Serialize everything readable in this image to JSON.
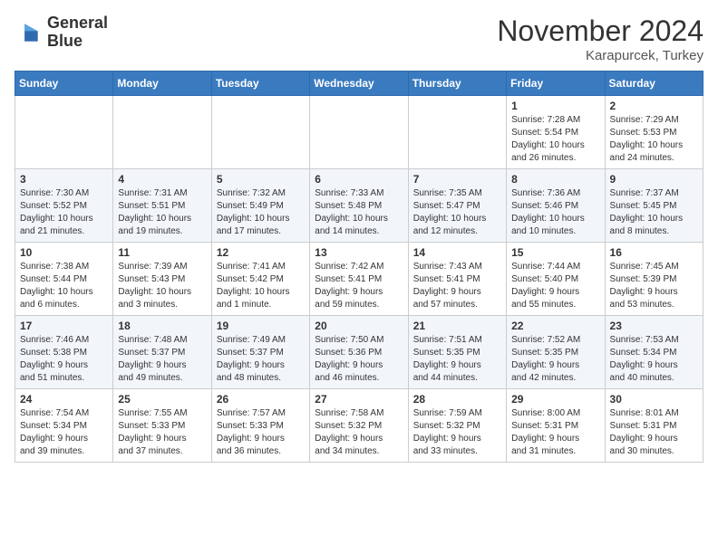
{
  "header": {
    "logo_line1": "General",
    "logo_line2": "Blue",
    "month": "November 2024",
    "location": "Karapurcek, Turkey"
  },
  "days_of_week": [
    "Sunday",
    "Monday",
    "Tuesday",
    "Wednesday",
    "Thursday",
    "Friday",
    "Saturday"
  ],
  "weeks": [
    [
      {
        "day": "",
        "info": ""
      },
      {
        "day": "",
        "info": ""
      },
      {
        "day": "",
        "info": ""
      },
      {
        "day": "",
        "info": ""
      },
      {
        "day": "",
        "info": ""
      },
      {
        "day": "1",
        "info": "Sunrise: 7:28 AM\nSunset: 5:54 PM\nDaylight: 10 hours\nand 26 minutes."
      },
      {
        "day": "2",
        "info": "Sunrise: 7:29 AM\nSunset: 5:53 PM\nDaylight: 10 hours\nand 24 minutes."
      }
    ],
    [
      {
        "day": "3",
        "info": "Sunrise: 7:30 AM\nSunset: 5:52 PM\nDaylight: 10 hours\nand 21 minutes."
      },
      {
        "day": "4",
        "info": "Sunrise: 7:31 AM\nSunset: 5:51 PM\nDaylight: 10 hours\nand 19 minutes."
      },
      {
        "day": "5",
        "info": "Sunrise: 7:32 AM\nSunset: 5:49 PM\nDaylight: 10 hours\nand 17 minutes."
      },
      {
        "day": "6",
        "info": "Sunrise: 7:33 AM\nSunset: 5:48 PM\nDaylight: 10 hours\nand 14 minutes."
      },
      {
        "day": "7",
        "info": "Sunrise: 7:35 AM\nSunset: 5:47 PM\nDaylight: 10 hours\nand 12 minutes."
      },
      {
        "day": "8",
        "info": "Sunrise: 7:36 AM\nSunset: 5:46 PM\nDaylight: 10 hours\nand 10 minutes."
      },
      {
        "day": "9",
        "info": "Sunrise: 7:37 AM\nSunset: 5:45 PM\nDaylight: 10 hours\nand 8 minutes."
      }
    ],
    [
      {
        "day": "10",
        "info": "Sunrise: 7:38 AM\nSunset: 5:44 PM\nDaylight: 10 hours\nand 6 minutes."
      },
      {
        "day": "11",
        "info": "Sunrise: 7:39 AM\nSunset: 5:43 PM\nDaylight: 10 hours\nand 3 minutes."
      },
      {
        "day": "12",
        "info": "Sunrise: 7:41 AM\nSunset: 5:42 PM\nDaylight: 10 hours\nand 1 minute."
      },
      {
        "day": "13",
        "info": "Sunrise: 7:42 AM\nSunset: 5:41 PM\nDaylight: 9 hours\nand 59 minutes."
      },
      {
        "day": "14",
        "info": "Sunrise: 7:43 AM\nSunset: 5:41 PM\nDaylight: 9 hours\nand 57 minutes."
      },
      {
        "day": "15",
        "info": "Sunrise: 7:44 AM\nSunset: 5:40 PM\nDaylight: 9 hours\nand 55 minutes."
      },
      {
        "day": "16",
        "info": "Sunrise: 7:45 AM\nSunset: 5:39 PM\nDaylight: 9 hours\nand 53 minutes."
      }
    ],
    [
      {
        "day": "17",
        "info": "Sunrise: 7:46 AM\nSunset: 5:38 PM\nDaylight: 9 hours\nand 51 minutes."
      },
      {
        "day": "18",
        "info": "Sunrise: 7:48 AM\nSunset: 5:37 PM\nDaylight: 9 hours\nand 49 minutes."
      },
      {
        "day": "19",
        "info": "Sunrise: 7:49 AM\nSunset: 5:37 PM\nDaylight: 9 hours\nand 48 minutes."
      },
      {
        "day": "20",
        "info": "Sunrise: 7:50 AM\nSunset: 5:36 PM\nDaylight: 9 hours\nand 46 minutes."
      },
      {
        "day": "21",
        "info": "Sunrise: 7:51 AM\nSunset: 5:35 PM\nDaylight: 9 hours\nand 44 minutes."
      },
      {
        "day": "22",
        "info": "Sunrise: 7:52 AM\nSunset: 5:35 PM\nDaylight: 9 hours\nand 42 minutes."
      },
      {
        "day": "23",
        "info": "Sunrise: 7:53 AM\nSunset: 5:34 PM\nDaylight: 9 hours\nand 40 minutes."
      }
    ],
    [
      {
        "day": "24",
        "info": "Sunrise: 7:54 AM\nSunset: 5:34 PM\nDaylight: 9 hours\nand 39 minutes."
      },
      {
        "day": "25",
        "info": "Sunrise: 7:55 AM\nSunset: 5:33 PM\nDaylight: 9 hours\nand 37 minutes."
      },
      {
        "day": "26",
        "info": "Sunrise: 7:57 AM\nSunset: 5:33 PM\nDaylight: 9 hours\nand 36 minutes."
      },
      {
        "day": "27",
        "info": "Sunrise: 7:58 AM\nSunset: 5:32 PM\nDaylight: 9 hours\nand 34 minutes."
      },
      {
        "day": "28",
        "info": "Sunrise: 7:59 AM\nSunset: 5:32 PM\nDaylight: 9 hours\nand 33 minutes."
      },
      {
        "day": "29",
        "info": "Sunrise: 8:00 AM\nSunset: 5:31 PM\nDaylight: 9 hours\nand 31 minutes."
      },
      {
        "day": "30",
        "info": "Sunrise: 8:01 AM\nSunset: 5:31 PM\nDaylight: 9 hours\nand 30 minutes."
      }
    ]
  ]
}
